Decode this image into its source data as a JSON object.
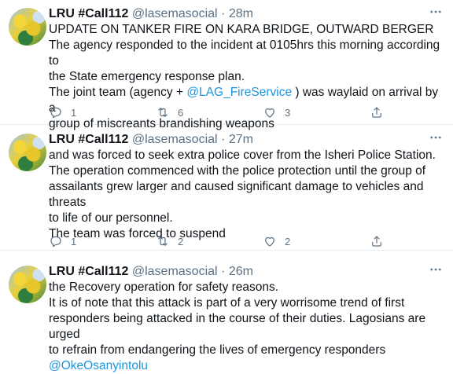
{
  "tweets": [
    {
      "name": "LRU #Call112",
      "handle": "@lasemasocial",
      "dot": "·",
      "time": "28m",
      "lines": [
        "UPDATE ON TANKER FIRE ON KARA BRIDGE, OUTWARD BERGER",
        "The agency responded to the incident at 0105hrs this morning according to",
        "the State emergency response plan."
      ],
      "line4_pre": "The joint team (agency + ",
      "line4_link": "@LAG_FireService",
      "line4_post": " ) was waylaid on arrival by  a",
      "line5": "group of miscreants brandishing weapons",
      "reply_count": "1",
      "retweet_count": "6",
      "like_count": "3"
    },
    {
      "name": "LRU #Call112",
      "handle": "@lasemasocial",
      "dot": "·",
      "time": "27m",
      "lines": [
        "and was forced to seek extra police cover from the Isheri Police Station.",
        "The operation commenced with the police protection until the group of",
        "assailants grew larger and caused significant damage to vehicles and threats",
        "to life of our personnel.",
        "The team was forced to suspend"
      ],
      "reply_count": "1",
      "retweet_count": "2",
      "like_count": "2"
    },
    {
      "name": "LRU #Call112",
      "handle": "@lasemasocial",
      "dot": "·",
      "time": "26m",
      "lines": [
        "the Recovery operation for safety reasons.",
        "It is of note that this attack is part of a very worrisome trend of first",
        "responders being attacked in the course of their duties. Lagosians are urged",
        "to refrain from endangering the lives of emergency responders"
      ],
      "mention": "@OkeOsanyintolu"
    }
  ],
  "more_icon": "ellipsis-icon",
  "colors": {
    "link": "#1b95e0",
    "secondary": "#5b7083",
    "text": "#0f1419"
  }
}
